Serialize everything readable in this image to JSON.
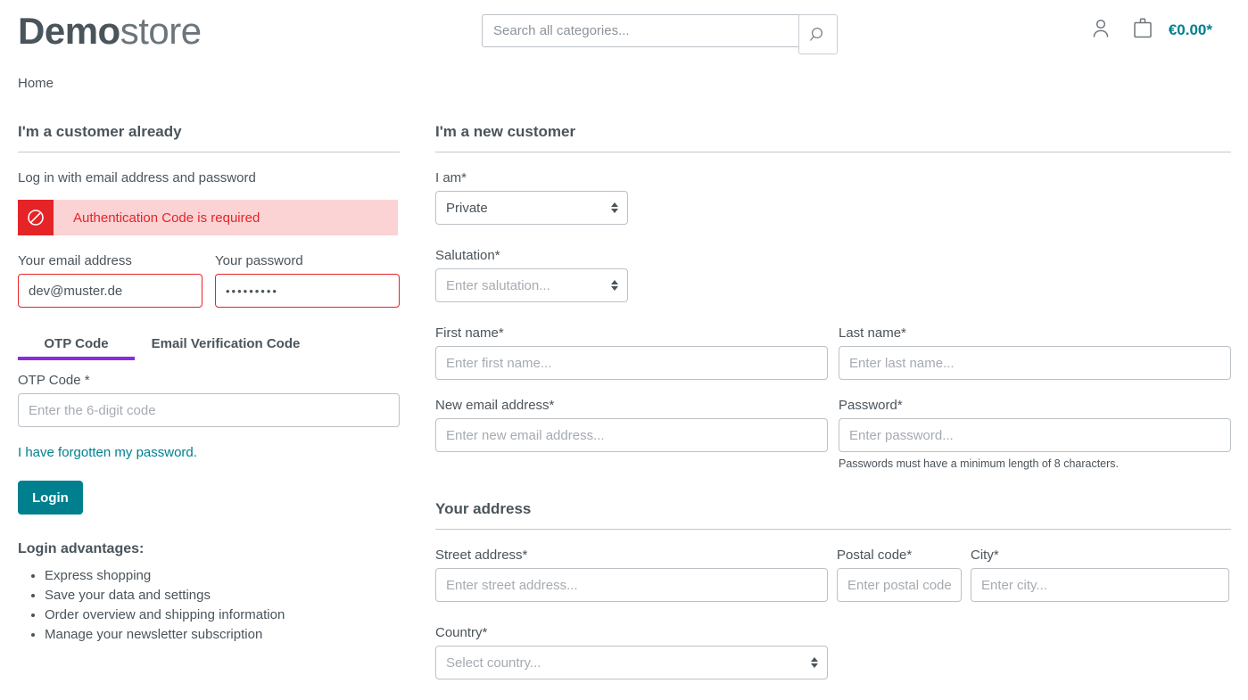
{
  "header": {
    "logo_bold": "Demo",
    "logo_light": "store",
    "search_placeholder": "Search all categories...",
    "search_value": "",
    "search_icon": "search-icon",
    "account_icon": "user-icon",
    "cart_icon": "shopping-bag-icon",
    "cart_total": "€0.00*"
  },
  "breadcrumb": {
    "home": "Home"
  },
  "login": {
    "title": "I'm a customer already",
    "subtitle": "Log in with email address and password",
    "alert": {
      "icon": "prohibited-icon",
      "message": "Authentication Code is required"
    },
    "email_label": "Your email address",
    "email_value": "dev@muster.de",
    "password_label": "Your password",
    "password_value": "•••••••••",
    "tabs": [
      {
        "label": "OTP Code",
        "active": true
      },
      {
        "label": "Email Verification Code",
        "active": false
      }
    ],
    "otp_label": "OTP Code *",
    "otp_placeholder": "Enter the 6-digit code",
    "otp_value": "",
    "forgot_link": "I have forgotten my password.",
    "login_button": "Login",
    "advantages_title": "Login advantages:",
    "advantages": [
      "Express shopping",
      "Save your data and settings",
      "Order overview and shipping information",
      "Manage your newsletter subscription"
    ]
  },
  "register": {
    "title": "I'm a new customer",
    "iam_label": "I am*",
    "iam_value": "Private",
    "iam_options": [
      "Private"
    ],
    "salutation_label": "Salutation*",
    "salutation_placeholder": "Enter salutation...",
    "salutation_value": "",
    "first_name_label": "First name*",
    "first_name_placeholder": "Enter first name...",
    "first_name_value": "",
    "last_name_label": "Last name*",
    "last_name_placeholder": "Enter last name...",
    "last_name_value": "",
    "new_email_label": "New email address*",
    "new_email_placeholder": "Enter new email address...",
    "new_email_value": "",
    "password_label": "Password*",
    "password_placeholder": "Enter password...",
    "password_value": "",
    "password_help": "Passwords must have a minimum length of 8 characters.",
    "address_title": "Your address",
    "street_label": "Street address*",
    "street_placeholder": "Enter street address...",
    "street_value": "",
    "postal_label": "Postal code*",
    "postal_placeholder": "Enter postal code.",
    "postal_value": "",
    "city_label": "City*",
    "city_placeholder": "Enter city...",
    "city_value": "",
    "country_label": "Country*",
    "country_placeholder": "Select country...",
    "country_value": ""
  },
  "colors": {
    "accent_teal": "#00808f",
    "tab_active": "#8a2be2",
    "error_red": "#e52427",
    "error_bg": "#fbd3d4",
    "text": "#4a545b",
    "border": "#bcc1c7"
  }
}
